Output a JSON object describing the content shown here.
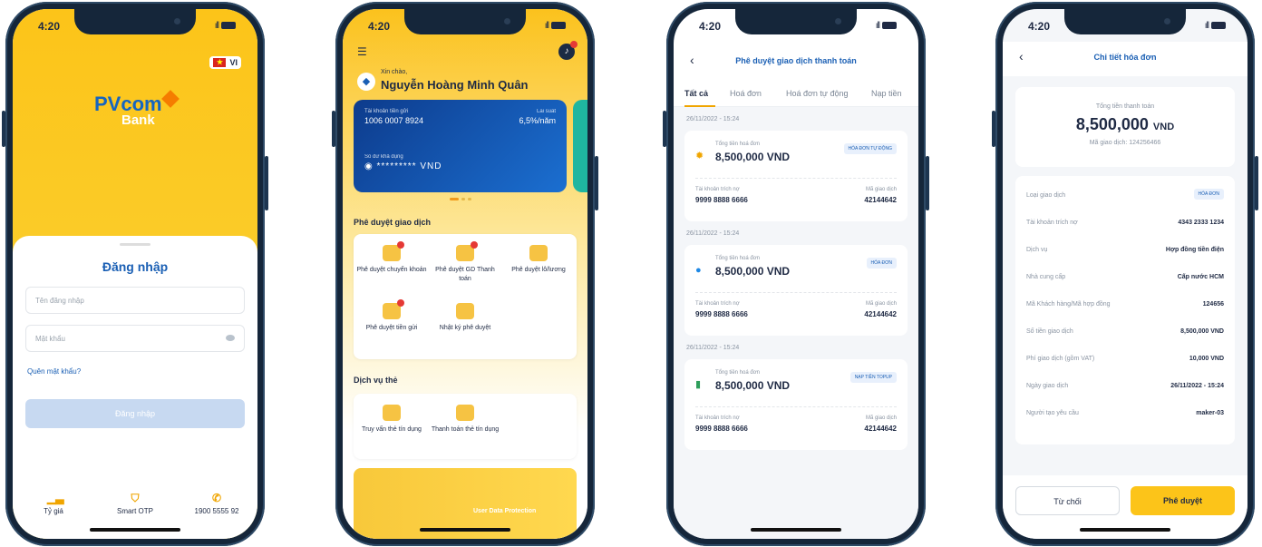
{
  "time": "4:20",
  "signal": "ıll",
  "phone1": {
    "lang": "VI",
    "logo_main": "PVcom",
    "logo_sub": "Bank",
    "title": "Đăng nhập",
    "username_placeholder": "Tên đăng nhập",
    "password_placeholder": "Mật khẩu",
    "forgot": "Quên mật khẩu?",
    "login_button": "Đăng nhập",
    "quick": [
      {
        "label": "Tỷ giá",
        "icon": "chart-icon"
      },
      {
        "label": "Smart OTP",
        "icon": "shield-icon"
      },
      {
        "label": "1900 5555 92",
        "icon": "phone-icon"
      }
    ]
  },
  "phone2": {
    "hello": "Xin chào,",
    "name": "Nguyễn Hoàng Minh Quân",
    "card": {
      "acc_label": "Tài khoản tiền gửi",
      "acc_no": "1006 0007 8924",
      "rate_label": "Lãi suất",
      "rate": "6,5%/năm",
      "bal_label": "Số dư khả dụng",
      "bal": "********* VND"
    },
    "section1": "Phê duyệt giao dịch",
    "tiles1": [
      "Phê duyệt chuyển khoản",
      "Phê duyệt GD Thanh toán",
      "Phê duyệt lô/lương",
      "Phê duyệt tiền gửi",
      "Nhật ký phê duyệt"
    ],
    "section2": "Dịch vụ thẻ",
    "tiles2": [
      "Truy vấn thẻ tín dụng",
      "Thanh toán thẻ tín dụng"
    ],
    "banner": "User Data Protection"
  },
  "phone3": {
    "title": "Phê duyệt giao dịch thanh toán",
    "tabs": [
      "Tất cả",
      "Hoá đơn",
      "Hoá đơn tự động",
      "Nạp tiền"
    ],
    "items": [
      {
        "date": "26/11/2022 - 15:24",
        "label": "Tổng tiền hoá đơn",
        "amount": "8,500,000 VND",
        "badge": "HÓA ĐƠN TỰ ĐỘNG",
        "k1": "Tài khoản trích nợ",
        "v1": "9999 8888 6666",
        "k2": "Mã giao dịch",
        "v2": "42144642"
      },
      {
        "date": "26/11/2022 - 15:24",
        "label": "Tổng tiền hoá đơn",
        "amount": "8,500,000 VND",
        "badge": "HÓA ĐƠN",
        "k1": "Tài khoản trích nợ",
        "v1": "9999 8888 6666",
        "k2": "Mã giao dịch",
        "v2": "42144642"
      },
      {
        "date": "26/11/2022 - 15:24",
        "label": "Tổng tiền hoá đơn",
        "amount": "8,500,000 VND",
        "badge": "NẠP TIỀN TOPUP",
        "k1": "Tài khoản trích nợ",
        "v1": "9999 8888 6666",
        "k2": "Mã giao dịch",
        "v2": "42144642"
      }
    ]
  },
  "phone4": {
    "title": "Chi tiết hóa đơn",
    "sum_label": "Tổng tiền thanh toán",
    "sum_amount": "8,500,000",
    "sum_unit": "VND",
    "code": "Mã giao dịch: 124256466",
    "rows": [
      {
        "k": "Loại giao dịch",
        "v": "HÓA ĐƠN"
      },
      {
        "k": "Tài khoản trích nợ",
        "v": "4343 2333 1234"
      },
      {
        "k": "Dịch vụ",
        "v": "Hợp đồng tiền điện"
      },
      {
        "k": "Nhà cung cấp",
        "v": "Cấp nước HCM"
      },
      {
        "k": "Mã Khách hàng/Mã hợp đồng",
        "v": "124656"
      },
      {
        "k": "Số tiền giao dịch",
        "v": "8,500,000 VND"
      },
      {
        "k": "Phí giao dịch (gồm VAT)",
        "v": "10,000 VND"
      },
      {
        "k": "Ngày giao dịch",
        "v": "26/11/2022 - 15:24"
      },
      {
        "k": "Người tạo yêu cầu",
        "v": "maker-03"
      }
    ],
    "reject": "Từ chối",
    "approve": "Phê duyệt"
  }
}
